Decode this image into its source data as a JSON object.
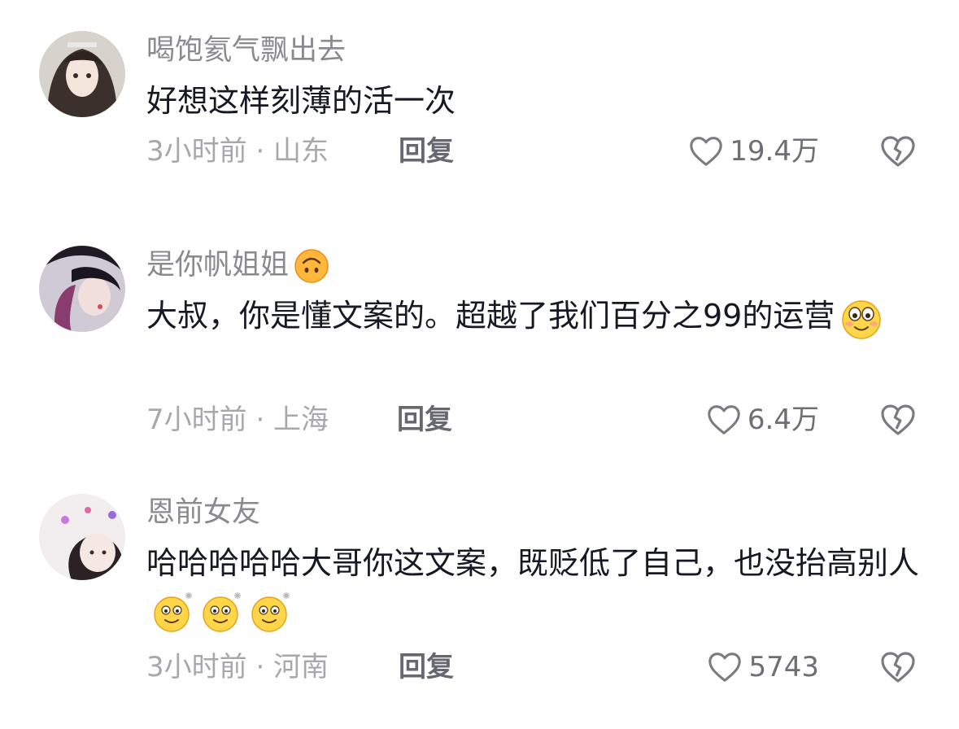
{
  "comments": [
    {
      "username": "喝饱氦气飘出去",
      "text": "好想这样刻薄的活一次",
      "time_location": "3小时前 · 山东",
      "reply_label": "回复",
      "likes": "19.4万"
    },
    {
      "username": "是你帆姐姐",
      "username_emoji": "upside-down-face-emoji",
      "text": "大叔，你是懂文案的。超越了我们百分之99的运营",
      "text_emoji": "smiling-face-emoji",
      "time_location": "7小时前 · 上海",
      "reply_label": "回复",
      "likes": "6.4万"
    },
    {
      "username": "恩前女友",
      "text": "哈哈哈哈哈大哥你这文案，既贬低了自己，也没抬高别人",
      "text_emojis": [
        "sparkle-smile-emoji",
        "sparkle-smile-emoji",
        "sparkle-smile-emoji"
      ],
      "time_location": "3小时前 · 河南",
      "reply_label": "回复",
      "likes": "5743"
    }
  ],
  "colors": {
    "username": "#8a8a8e",
    "text": "#161823",
    "meta": "#a8a8ac",
    "reply": "#666770",
    "icon": "#7a7a80",
    "background": "#ffffff"
  },
  "icons": {
    "like": "heart-outline-icon",
    "dislike": "broken-heart-icon"
  }
}
